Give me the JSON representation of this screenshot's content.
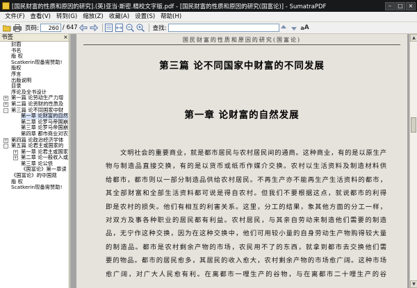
{
  "window": {
    "title": "[国民财富的性质和原因的研究].(英)亚当·斯密.精校文字版.pdf - [国民财富的性质和原因的研究(国富论)] - SumatraPDF"
  },
  "menu": [
    "文件(F)",
    "查看(V)",
    "转到(G)",
    "缩放(Z)",
    "收藏(A)",
    "设置(S)",
    "帮助(H)"
  ],
  "toolbar": {
    "page_label": "页码:",
    "current_page": "260",
    "total_pages": "/ 647",
    "find_label": "查找:",
    "find_value": ""
  },
  "sidebar": {
    "title": "书签",
    "close": "×",
    "bookmarks": [
      {
        "label": "封面",
        "level": 0,
        "expand": ""
      },
      {
        "label": "书名",
        "level": 0,
        "expand": ""
      },
      {
        "label": "版 权",
        "level": 0,
        "expand": ""
      },
      {
        "label": "Scatkerin现备需赞助!",
        "level": 0,
        "expand": ""
      },
      {
        "label": "版权",
        "level": 0,
        "expand": ""
      },
      {
        "label": "序言",
        "level": 0,
        "expand": ""
      },
      {
        "label": "出版说明",
        "level": 0,
        "expand": ""
      },
      {
        "label": "目录",
        "level": 0,
        "expand": ""
      },
      {
        "label": "序论及全书设计",
        "level": 0,
        "expand": ""
      },
      {
        "label": "第一篇 论劳动生产力增",
        "level": 0,
        "expand": "+"
      },
      {
        "label": "第二篇 论资财的性质及",
        "level": 0,
        "expand": "+"
      },
      {
        "label": "第三篇 论不同国家中财",
        "level": 0,
        "expand": "-"
      },
      {
        "label": "第一章 论财富的自然",
        "level": 1,
        "expand": "",
        "selected": true
      },
      {
        "label": "第二章 论罗马帝国崩",
        "level": 1,
        "expand": ""
      },
      {
        "label": "第三章 论罗马帝国崩",
        "level": 1,
        "expand": ""
      },
      {
        "label": "第四章 都市商业对农",
        "level": 1,
        "expand": ""
      },
      {
        "label": "第四篇 论政治经济学体",
        "level": 0,
        "expand": "+"
      },
      {
        "label": "第五篇 论君主或国家的",
        "level": 0,
        "expand": "-"
      },
      {
        "label": "第一章 论君主或国家",
        "level": 1,
        "expand": "+"
      },
      {
        "label": "第二章 论一般收入或",
        "level": 1,
        "expand": "+"
      },
      {
        "label": "第三章 论公债",
        "level": 1,
        "expand": ""
      },
      {
        "label": "《国富论》第一章读",
        "level": 1,
        "expand": ""
      },
      {
        "label": "《国富论》的中国观",
        "level": 0,
        "expand": ""
      },
      {
        "label": "版 权",
        "level": 0,
        "expand": ""
      },
      {
        "label": "Scatkerin现备需赞助!",
        "level": 0,
        "expand": ""
      }
    ]
  },
  "document": {
    "running_head": "国民财富的性质和原因的研究(国富论)",
    "part_title": "第三篇  论不同国家中财富的不同发展",
    "chapter_title": "第一章  论财富的自然发展",
    "body_lines": [
      "文明社会的重要商业，就是都市居民与农村居民间的通商。这种商业，有的是以原生产",
      "物与制造品直接交换，有的是以货币或纸币作媒介交换。农村以生活资料及制造材料供",
      "给都市，都市则以一部分制造品供给农村居民。不再生产亦不能再生产生活资料的都市，",
      "其全部财富和全部生活资料都可说是得自农村。但我们不要根据这点，就说都市的利得",
      "即是农村的损失。他们有相互的利害关系。这里，分工的结果，象其他方面的分工一样，",
      "对双方及事各种职业的居民都有利益。农村居民，与其亲自劳动来制造他们需要的制造",
      "品，无宁作这种交换，因为在这种交换中，他们可用较小量的自身劳动生产物购得较大量",
      "的制造品。都市是农村剩余产物的市场，农民用不了的东西，就拿到都市去交换他们需",
      "要的物品。都市的居民愈多，其居民的收入愈大，农村剩余产物的市场愈广阔。这种市场",
      "愈广阔，对广大人民愈有利。在离都市一哩生产的谷物，与在离都市二十哩生产的谷"
    ]
  }
}
